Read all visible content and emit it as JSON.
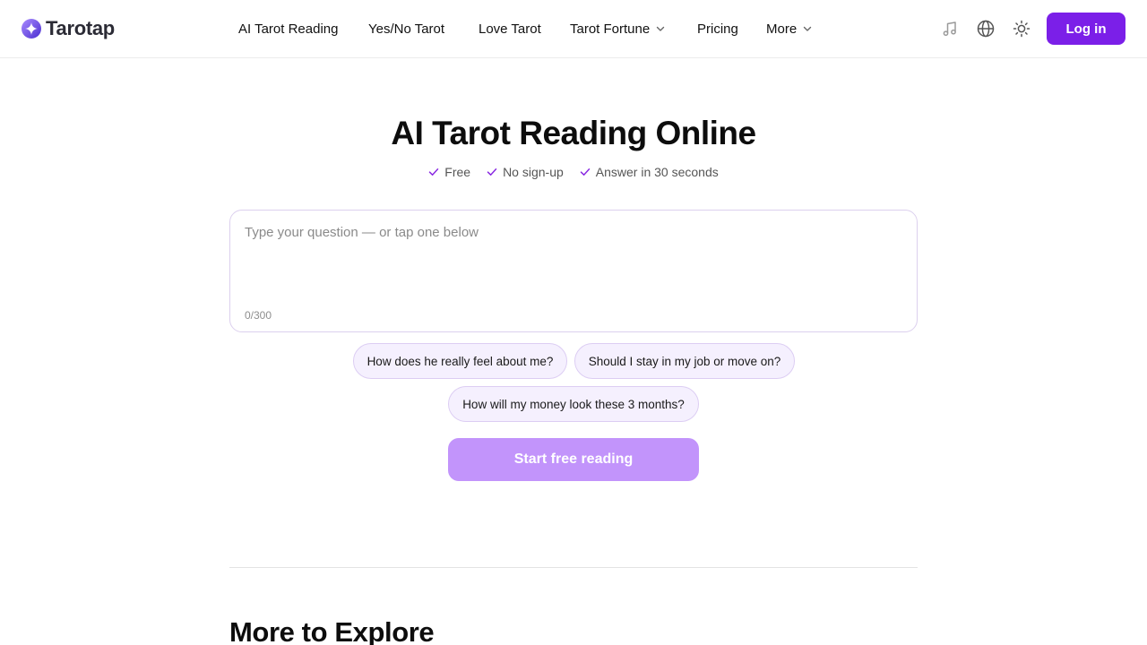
{
  "brand": {
    "name": "Tarotap",
    "logo_icon": "sparkle-logo-icon",
    "accent": "#7b1fe8"
  },
  "nav": {
    "items": [
      {
        "label": "AI Tarot Reading",
        "dropdown": false
      },
      {
        "label": "Yes/No Tarot",
        "dropdown": false
      },
      {
        "label": "Love Tarot",
        "dropdown": false
      },
      {
        "label": "Tarot Fortune",
        "dropdown": true
      },
      {
        "label": "Pricing",
        "dropdown": false
      },
      {
        "label": "More",
        "dropdown": true
      }
    ]
  },
  "header_actions": {
    "icons": [
      "music-icon",
      "globe-icon",
      "sun-icon"
    ],
    "login_label": "Log in"
  },
  "hero": {
    "title": "AI Tarot Reading Online",
    "features": [
      "Free",
      "No sign-up",
      "Answer in 30 seconds"
    ]
  },
  "question": {
    "placeholder": "Type your question — or tap one below",
    "value": "",
    "char_count": "0/300"
  },
  "suggestions": [
    "How does he really feel about me?",
    "Should I stay in my job or move on?",
    "How will my money look these 3 months?"
  ],
  "start_label": "Start free reading",
  "explore": {
    "title": "More to Explore"
  },
  "colors": {
    "primary": "#7b1fe8",
    "start_button": "#c294fb",
    "chip_bg": "#f5f0fe",
    "chip_border": "#dccdf3",
    "check": "#8a2be2"
  }
}
